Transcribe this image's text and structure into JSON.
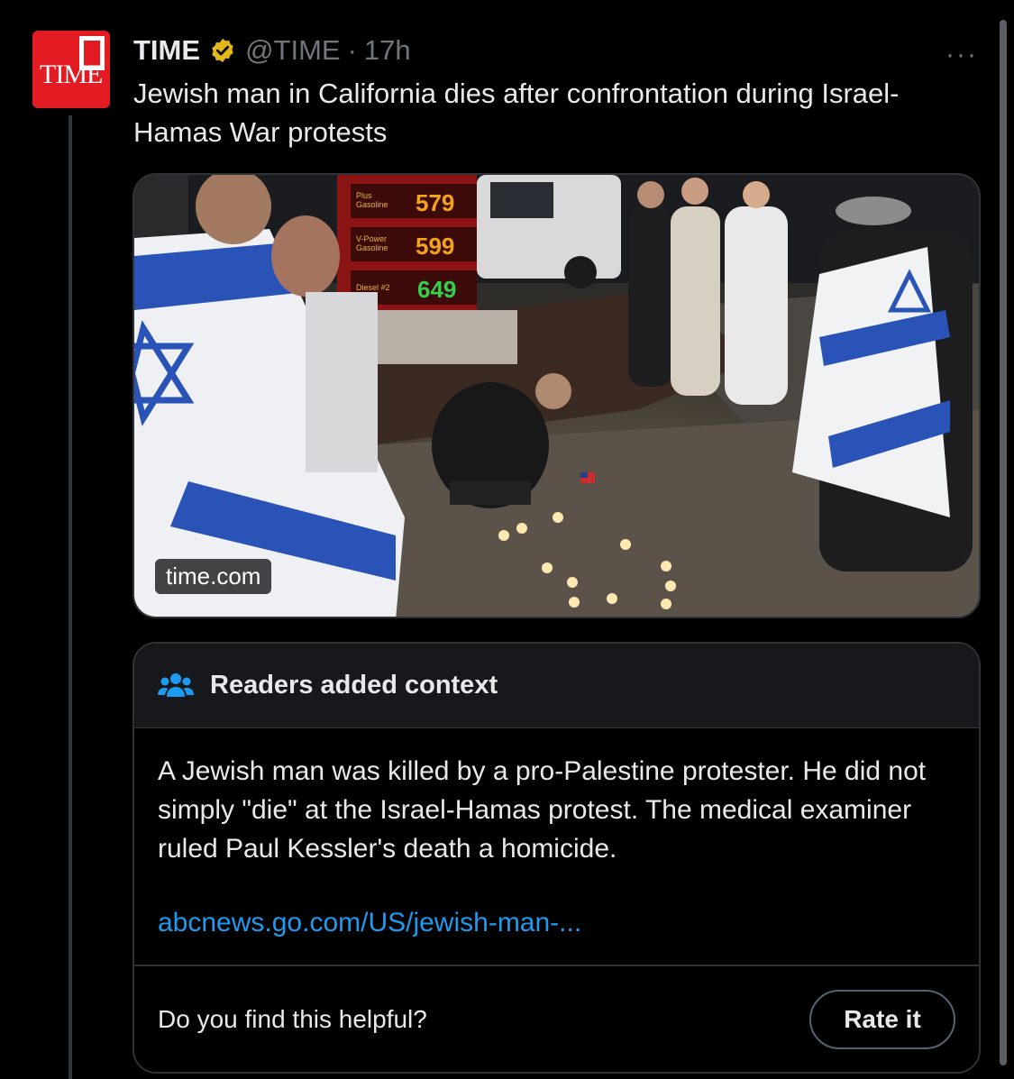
{
  "tweet": {
    "author_name": "TIME",
    "handle": "@TIME",
    "separator": "·",
    "time_ago": "17h",
    "text": "Jewish man in California dies after confrontation during Israel-Hamas War protests",
    "more_label": "···",
    "avatar_text": "TIME"
  },
  "media": {
    "source_tag": "time.com",
    "price_sign": {
      "rows": [
        {
          "label_1": "Plus",
          "label_2": "Gasoline",
          "price": "579"
        },
        {
          "label_1": "V-Power",
          "label_2": "Gasoline",
          "price": "599"
        },
        {
          "label_1": "Diesel #2",
          "label_2": "",
          "price": "649"
        }
      ]
    }
  },
  "community_note": {
    "title": "Readers added context",
    "body": "A Jewish man was killed by a pro-Palestine protester. He did not simply \"die\" at the Israel-Hamas protest. The medical examiner ruled Paul Kessler's death a homicide.",
    "link": "abcnews.go.com/US/jewish-man-...",
    "question": "Do you find this helpful?",
    "rate_button": "Rate it"
  },
  "colors": {
    "background": "#000000",
    "text": "#e7e9ea",
    "muted": "#71767b",
    "link": "#1d9bf0",
    "verified": "#e2b719",
    "note_icon": "#1d9bf0",
    "time_red": "#e31b23"
  }
}
